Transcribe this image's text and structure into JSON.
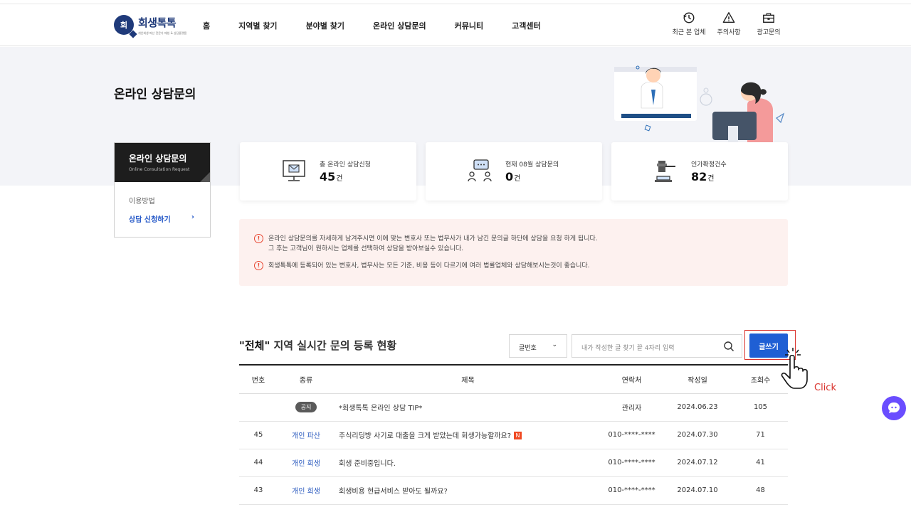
{
  "header": {
    "logo_mark": "회",
    "logo_name": "회생톡톡",
    "logo_sub": "개인회생 파산 전문가 매칭 & 상담플랫폼",
    "nav": [
      "홈",
      "지역별 찾기",
      "분야별 찾기",
      "온라인 상담문의",
      "커뮤니티",
      "고객센터"
    ],
    "utils": [
      {
        "label": "최근 본 업체",
        "icon": "clock-icon"
      },
      {
        "label": "주의사항",
        "icon": "warning-icon"
      },
      {
        "label": "광고문의",
        "icon": "briefcase-icon"
      }
    ]
  },
  "page_title": "온라인 상담문의",
  "side": {
    "title": "온라인 상담문의",
    "subtitle": "Online Consultation Request",
    "items": [
      "이용방법",
      "상담 신청하기"
    ],
    "chevron": "›"
  },
  "stats": [
    {
      "label": "총 온라인 상담신청",
      "value": "45",
      "unit": "건",
      "icon": "monitor-mail-icon"
    },
    {
      "label": "현재 08월 상담문의",
      "value": "0",
      "unit": "건",
      "icon": "chat-people-icon"
    },
    {
      "label": "인가확정건수",
      "value": "82",
      "unit": "건",
      "icon": "gavel-icon"
    }
  ],
  "notice": {
    "line1": "온라인 상담문의를 자세하게 남겨주시면 이에 맞는 변호사 또는 법무사가 내가 남긴 문의글 하단에 상담을 요청 하게 됩니다.",
    "line1b": "그 후는 고객님이 원하시는 업체를 선택하여 상담을 받아보실수 있습니다.",
    "line2": "회생톡톡에 등록되어 있는 변호사, 법무사는 모든 기준, 비용 등이 다르기에 여러 법률업체와 상담해보시는것이 좋습니다.",
    "mark": "!"
  },
  "board": {
    "title_quote_open": "\"",
    "title_strong": "전체",
    "title_quote_close": "\"",
    "title_rest": " 지역 실시간 문의 등록 현황",
    "select_value": "글번호",
    "select_chevron": "⌄",
    "search_placeholder": "내가 작성한 글 찾기 끝 4자리 입력",
    "write_label": "글쓰기",
    "columns": [
      "번호",
      "종류",
      "제목",
      "연락처",
      "작성일",
      "조회수"
    ],
    "rows": [
      {
        "no": "",
        "kind": "공지",
        "title": "*회생톡톡 온라인 상담 TIP*",
        "contact": "관리자",
        "date": "2024.06.23",
        "views": "105",
        "new": ""
      },
      {
        "no": "45",
        "kind": "개인 파산",
        "title": "주식리딩방 사기로 대출을 크게 받았는데 회생가능할까요?",
        "contact": "010-****-****",
        "date": "2024.07.30",
        "views": "71",
        "new": "N"
      },
      {
        "no": "44",
        "kind": "개인 회생",
        "title": "회생 준비중입니다.",
        "contact": "010-****-****",
        "date": "2024.07.12",
        "views": "41",
        "new": ""
      },
      {
        "no": "43",
        "kind": "개인 회생",
        "title": "회생비용 현급서비스 받아도 될까요?",
        "contact": "010-****-****",
        "date": "2024.07.10",
        "views": "48",
        "new": ""
      }
    ]
  },
  "annotation": {
    "click_label": "Click"
  },
  "colors": {
    "accent": "#1f5fd4",
    "notice_bg": "#fdf1ef",
    "warn": "#e8452f",
    "chat": "#6a4dff"
  }
}
